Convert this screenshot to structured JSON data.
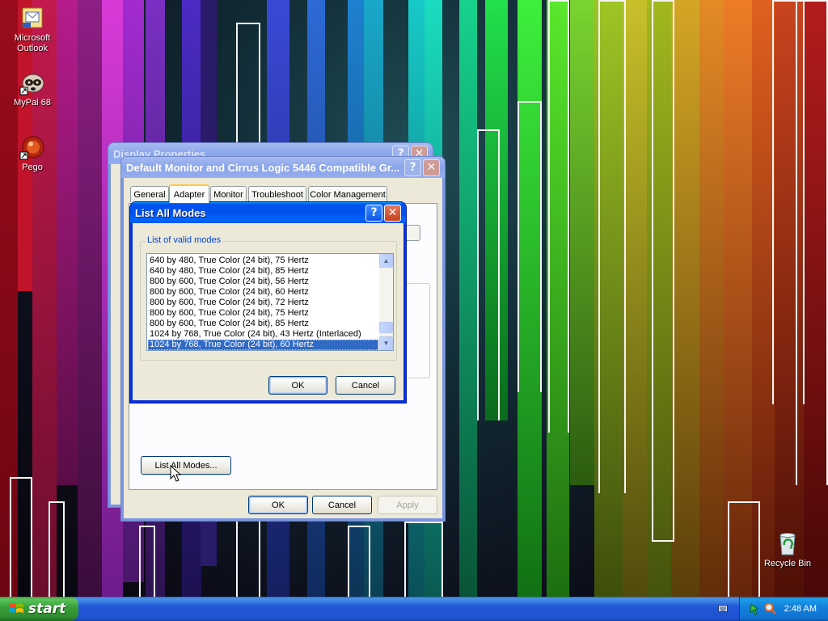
{
  "desktop": {
    "icons": [
      {
        "label_line1": "Microsoft",
        "label_line2": "Outlook",
        "icon": "outlook-icon"
      },
      {
        "label_line1": "MyPal 68",
        "label_line2": "",
        "icon": "mypal-icon"
      },
      {
        "label_line1": "Pego",
        "label_line2": "",
        "icon": "pego-icon"
      },
      {
        "label_line1": "Recycle Bin",
        "label_line2": "",
        "icon": "recycle-bin-icon"
      }
    ]
  },
  "display_properties_window": {
    "title": "Display Properties",
    "help_glyph": "?",
    "close_glyph": "✕"
  },
  "adapter_window": {
    "title": "Default Monitor and Cirrus Logic 5446 Compatible Gr...",
    "help_glyph": "?",
    "close_glyph": "✕",
    "tabs": [
      "General",
      "Adapter",
      "Monitor",
      "Troubleshoot",
      "Color Management"
    ],
    "active_tab": "Adapter",
    "list_all_modes_label": "List All Modes...",
    "ok_label": "OK",
    "cancel_label": "Cancel",
    "apply_label": "Apply"
  },
  "list_all_modes_dialog": {
    "title": "List All Modes",
    "help_glyph": "?",
    "close_glyph": "✕",
    "group_label": "List of valid modes",
    "modes": [
      "640 by 480, True Color (24 bit), 75 Hertz",
      "640 by 480, True Color (24 bit), 85 Hertz",
      "800 by 600, True Color (24 bit), 56 Hertz",
      "800 by 600, True Color (24 bit), 60 Hertz",
      "800 by 600, True Color (24 bit), 72 Hertz",
      "800 by 600, True Color (24 bit), 75 Hertz",
      "800 by 600, True Color (24 bit), 85 Hertz",
      "1024 by 768, True Color (24 bit), 43 Hertz (Interlaced)",
      "1024 by 768, True Color (24 bit), 60 Hertz"
    ],
    "selected_index": 8,
    "ok_label": "OK",
    "cancel_label": "Cancel"
  },
  "taskbar": {
    "start_label": "start",
    "clock": "2:48 AM"
  },
  "colors": {
    "xp_blue": "#0831d9",
    "dialog_face": "#ece9d8",
    "selection": "#316ac5",
    "start_green": "#3c9a3c"
  }
}
